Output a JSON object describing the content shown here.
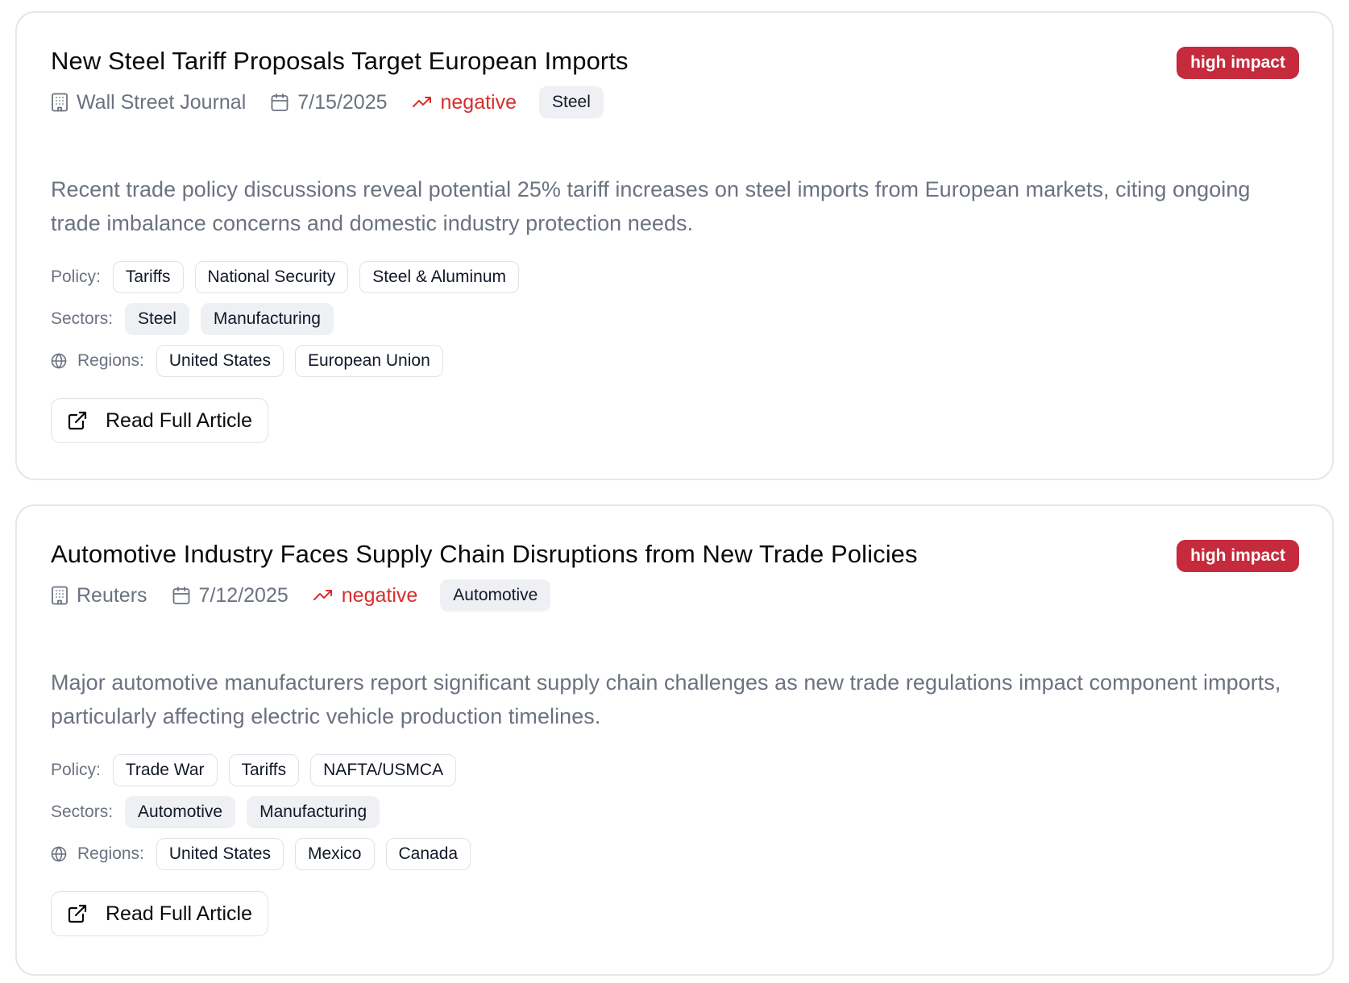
{
  "articles": [
    {
      "title": "New Steel Tariff Proposals Target European Imports",
      "impact": "high impact",
      "source": "Wall Street Journal",
      "date": "7/15/2025",
      "sentiment": "negative",
      "sector_badge": "Steel",
      "summary": "Recent trade policy discussions reveal potential 25% tariff increases on steel imports from European markets, citing ongoing trade imbalance concerns and domestic industry protection needs.",
      "policy_label": "Policy:",
      "policies": [
        "Tariffs",
        "National Security",
        "Steel & Aluminum"
      ],
      "sectors_label": "Sectors:",
      "sectors": [
        "Steel",
        "Manufacturing"
      ],
      "regions_label": "Regions:",
      "regions": [
        "United States",
        "European Union"
      ],
      "read_label": "Read Full Article"
    },
    {
      "title": "Automotive Industry Faces Supply Chain Disruptions from New Trade Policies",
      "impact": "high impact",
      "source": "Reuters",
      "date": "7/12/2025",
      "sentiment": "negative",
      "sector_badge": "Automotive",
      "summary": "Major automotive manufacturers report significant supply chain challenges as new trade regulations impact component imports, particularly affecting electric vehicle production timelines.",
      "policy_label": "Policy:",
      "policies": [
        "Trade War",
        "Tariffs",
        "NAFTA/USMCA"
      ],
      "sectors_label": "Sectors:",
      "sectors": [
        "Automotive",
        "Manufacturing"
      ],
      "regions_label": "Regions:",
      "regions": [
        "United States",
        "Mexico",
        "Canada"
      ],
      "read_label": "Read Full Article"
    }
  ],
  "icons": {
    "source": "building-icon",
    "date": "calendar-icon",
    "sentiment": "trending-icon",
    "regions": "globe-icon",
    "read": "external-link-icon"
  },
  "colors": {
    "impact_high": "#c52a3d",
    "sentiment_negative": "#d92d2d",
    "muted_text": "#6b7280",
    "border": "#e5e7eb"
  }
}
